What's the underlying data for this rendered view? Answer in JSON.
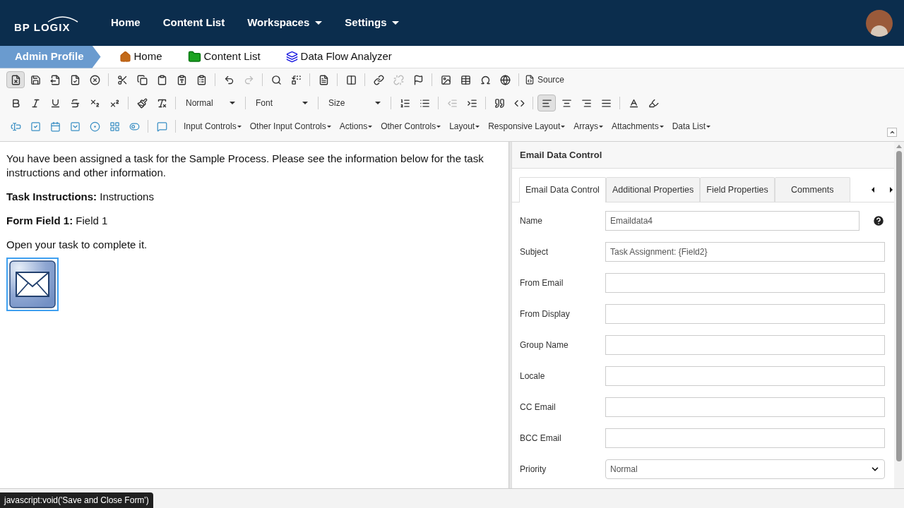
{
  "header": {
    "logo": "BP LOGIX",
    "nav": [
      {
        "label": "Home",
        "dropdown": false
      },
      {
        "label": "Content List",
        "dropdown": false
      },
      {
        "label": "Workspaces",
        "dropdown": true
      },
      {
        "label": "Settings",
        "dropdown": true
      }
    ]
  },
  "breadcrumb": {
    "profile": "Admin Profile",
    "links": [
      {
        "label": "Home"
      },
      {
        "label": "Content List"
      },
      {
        "label": "Data Flow Analyzer"
      }
    ]
  },
  "toolbar": {
    "save_close_pressed": true,
    "source": "Source",
    "style": "Normal",
    "font": "Font",
    "size": "Size",
    "align": [
      {
        "selected": true
      },
      {
        "selected": false
      },
      {
        "selected": false
      },
      {
        "selected": false
      }
    ],
    "menus": [
      "Input Controls",
      "Other Input Controls",
      "Actions",
      "Other Controls",
      "Layout",
      "Responsive Layout",
      "Arrays",
      "Attachments",
      "Data List"
    ]
  },
  "editor": {
    "paragraphs": [
      "You have been assigned a task for the Sample Process. Please see the information below for the task instructions and other information.",
      "**Task Instructions:** Instructions",
      "**Form Field 1:** Field 1",
      "Open your task to complete it."
    ],
    "email_image_selected": true
  },
  "panel": {
    "title": "Email Data Control",
    "tabs": [
      {
        "label": "Email Data Control",
        "selected": true
      },
      {
        "label": "Additional Properties",
        "selected": false
      },
      {
        "label": "Field Properties",
        "selected": false
      },
      {
        "label": "Comments",
        "selected": false
      }
    ],
    "fields": [
      {
        "label": "Name",
        "value": "Emaildata4",
        "kind": "text",
        "help": true
      },
      {
        "label": "Subject",
        "value": "Task Assignment: {Field2}",
        "kind": "text",
        "help": false
      },
      {
        "label": "From Email",
        "kind": "text",
        "help": false
      },
      {
        "label": "From Display",
        "kind": "text",
        "help": false
      },
      {
        "label": "Group Name",
        "kind": "text",
        "help": false
      },
      {
        "label": "Locale",
        "kind": "text",
        "help": false
      },
      {
        "label": "CC Email",
        "kind": "text",
        "help": false
      },
      {
        "label": "BCC Email",
        "kind": "text",
        "help": false
      },
      {
        "label": "Priority",
        "value": "Normal",
        "kind": "select",
        "help": false
      }
    ]
  },
  "status_tooltip": "javascript:void('Save and Close Form')"
}
